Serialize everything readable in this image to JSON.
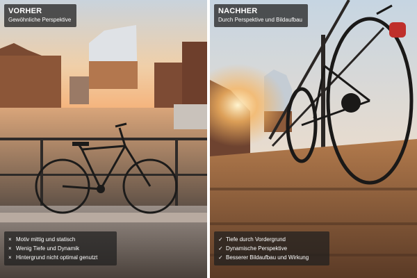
{
  "before": {
    "title": "VORHER",
    "subtitle": "Gewöhnliche Perspektive",
    "notes": [
      {
        "icon": "cross-icon",
        "mark": "×",
        "text": "Motiv mittig und statisch"
      },
      {
        "icon": "cross-icon",
        "mark": "×",
        "text": "Wenig Tiefe und Dynamik"
      },
      {
        "icon": "cross-icon",
        "mark": "×",
        "text": "Hintergrund nicht optimal genutzt"
      }
    ]
  },
  "after": {
    "title": "NACHHER",
    "subtitle": "Durch Perspektive und Bildaufbau",
    "notes": [
      {
        "icon": "check-icon",
        "mark": "✓",
        "text": "Tiefe durch Vordergrund"
      },
      {
        "icon": "check-icon",
        "mark": "✓",
        "text": "Dynamische Perspektive"
      },
      {
        "icon": "check-icon",
        "mark": "✓",
        "text": "Besserer Bildaufbau und Wirkung"
      }
    ]
  },
  "colors": {
    "sky_left": "#f3c79a",
    "sky_right": "#d8e3ee",
    "water": "#8a7460",
    "pavement": "#5c4a3e",
    "overlay": "#282828"
  }
}
